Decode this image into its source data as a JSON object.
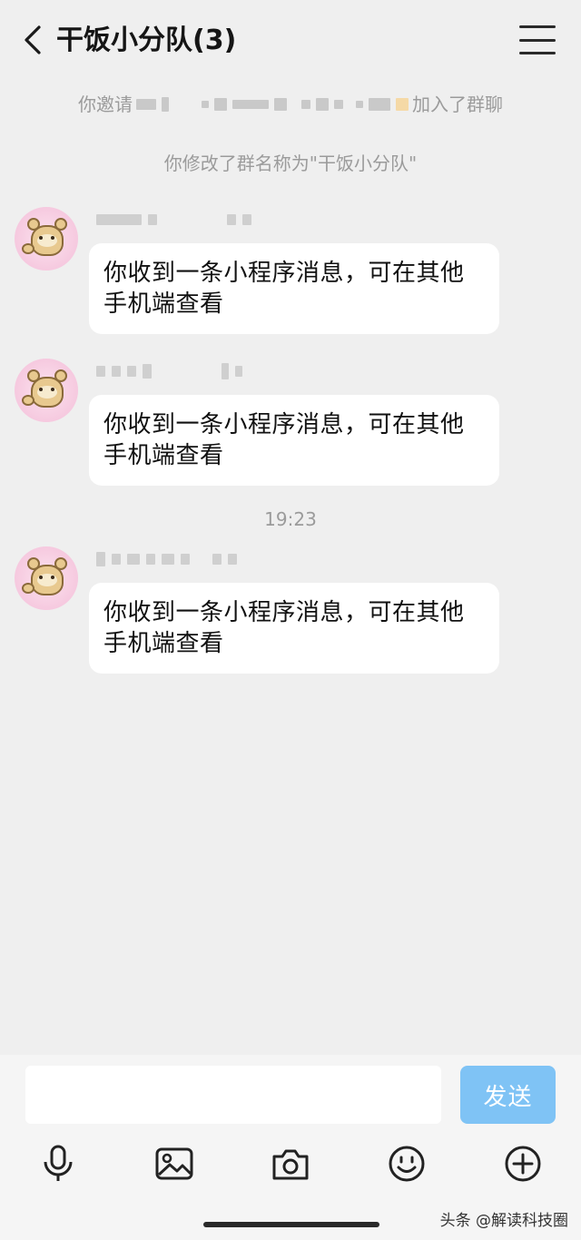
{
  "header": {
    "title": "干饭小分队(3)"
  },
  "system": {
    "invite_prefix": "你邀请",
    "invite_suffix": "加入了群聊",
    "rename": "你修改了群名称为\"干饭小分队\""
  },
  "messages": [
    {
      "text": "你收到一条小程序消息，可在其他手机端查看"
    },
    {
      "text": "你收到一条小程序消息，可在其他手机端查看"
    },
    {
      "text": "你收到一条小程序消息，可在其他手机端查看"
    }
  ],
  "timestamp": "19:23",
  "composer": {
    "send_label": "发送"
  },
  "toolbar": [
    "mic-icon",
    "image-icon",
    "camera-icon",
    "emoji-icon",
    "plus-icon"
  ],
  "watermark": "头条 @解读科技圈",
  "colors": {
    "background": "#efefef",
    "bubble": "#ffffff",
    "send_button": "#7fc3f5",
    "system_text": "#9b9b9b"
  }
}
